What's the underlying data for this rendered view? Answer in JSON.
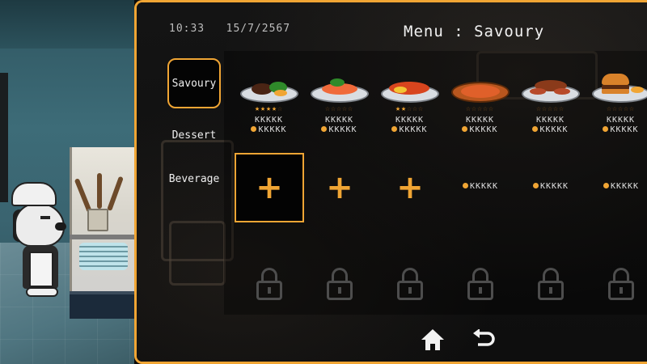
{
  "status": {
    "time": "10:33",
    "date": "15/7/2567"
  },
  "menu": {
    "title": "Menu : Savoury"
  },
  "categories": [
    {
      "label": "Savoury",
      "active": true
    },
    {
      "label": "Dessert",
      "active": false
    },
    {
      "label": "Beverage",
      "active": false
    }
  ],
  "dishes": [
    {
      "icon": "steak-dish-icon",
      "stars": 4,
      "name": "KKKKK",
      "price": "KKKKK"
    },
    {
      "icon": "sashimi-dish-icon",
      "stars": 0,
      "name": "KKKKK",
      "price": "KKKKK"
    },
    {
      "icon": "fried-fish-dish-icon",
      "stars": 2,
      "name": "KKKKK",
      "price": "KKKKK"
    },
    {
      "icon": "pizza-dish-icon",
      "stars": 0,
      "name": "KKKKK",
      "price": "KKKKK"
    },
    {
      "icon": "sausage-dish-icon",
      "stars": 0,
      "name": "KKKKK",
      "price": "KKKKK"
    },
    {
      "icon": "burger-dish-icon",
      "stars": 0,
      "name": "KKKKK",
      "price": "KKKKK"
    }
  ],
  "slots_row2": [
    {
      "type": "add",
      "symbol": "+",
      "selected": true
    },
    {
      "type": "add",
      "symbol": "+",
      "selected": false
    },
    {
      "type": "add",
      "symbol": "+",
      "selected": false
    },
    {
      "type": "buy",
      "price": "KKKKK"
    },
    {
      "type": "buy",
      "price": "KKKKK"
    },
    {
      "type": "buy",
      "price": "KKKKK"
    }
  ],
  "slots_row3": [
    "locked",
    "locked",
    "locked",
    "locked",
    "locked",
    "locked"
  ],
  "colors": {
    "accent": "#f0a534",
    "panel_bg": "#0c0c0c",
    "text": "#e8e8e8"
  },
  "footer": {
    "home_icon": "home-icon",
    "back_icon": "back-arrow-icon"
  }
}
